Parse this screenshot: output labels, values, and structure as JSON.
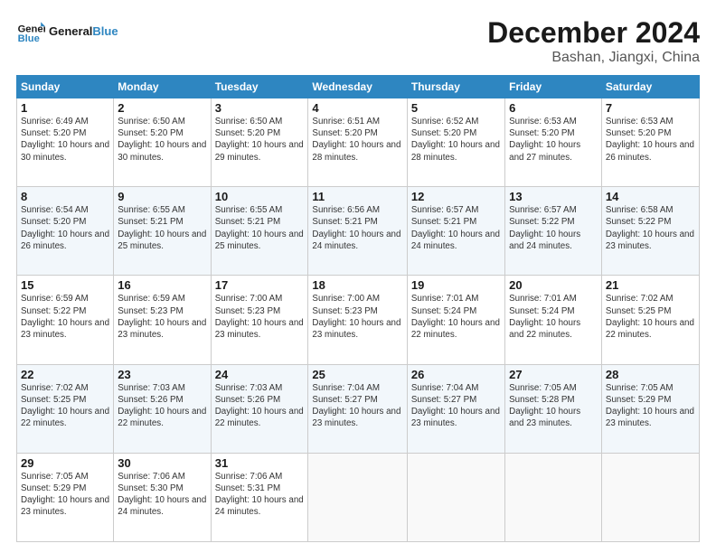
{
  "header": {
    "logo_line1": "General",
    "logo_line2": "Blue",
    "month": "December 2024",
    "location": "Bashan, Jiangxi, China"
  },
  "weekdays": [
    "Sunday",
    "Monday",
    "Tuesday",
    "Wednesday",
    "Thursday",
    "Friday",
    "Saturday"
  ],
  "weeks": [
    [
      {
        "day": "1",
        "sunrise": "Sunrise: 6:49 AM",
        "sunset": "Sunset: 5:20 PM",
        "daylight": "Daylight: 10 hours and 30 minutes."
      },
      {
        "day": "2",
        "sunrise": "Sunrise: 6:50 AM",
        "sunset": "Sunset: 5:20 PM",
        "daylight": "Daylight: 10 hours and 30 minutes."
      },
      {
        "day": "3",
        "sunrise": "Sunrise: 6:50 AM",
        "sunset": "Sunset: 5:20 PM",
        "daylight": "Daylight: 10 hours and 29 minutes."
      },
      {
        "day": "4",
        "sunrise": "Sunrise: 6:51 AM",
        "sunset": "Sunset: 5:20 PM",
        "daylight": "Daylight: 10 hours and 28 minutes."
      },
      {
        "day": "5",
        "sunrise": "Sunrise: 6:52 AM",
        "sunset": "Sunset: 5:20 PM",
        "daylight": "Daylight: 10 hours and 28 minutes."
      },
      {
        "day": "6",
        "sunrise": "Sunrise: 6:53 AM",
        "sunset": "Sunset: 5:20 PM",
        "daylight": "Daylight: 10 hours and 27 minutes."
      },
      {
        "day": "7",
        "sunrise": "Sunrise: 6:53 AM",
        "sunset": "Sunset: 5:20 PM",
        "daylight": "Daylight: 10 hours and 26 minutes."
      }
    ],
    [
      {
        "day": "8",
        "sunrise": "Sunrise: 6:54 AM",
        "sunset": "Sunset: 5:20 PM",
        "daylight": "Daylight: 10 hours and 26 minutes."
      },
      {
        "day": "9",
        "sunrise": "Sunrise: 6:55 AM",
        "sunset": "Sunset: 5:21 PM",
        "daylight": "Daylight: 10 hours and 25 minutes."
      },
      {
        "day": "10",
        "sunrise": "Sunrise: 6:55 AM",
        "sunset": "Sunset: 5:21 PM",
        "daylight": "Daylight: 10 hours and 25 minutes."
      },
      {
        "day": "11",
        "sunrise": "Sunrise: 6:56 AM",
        "sunset": "Sunset: 5:21 PM",
        "daylight": "Daylight: 10 hours and 24 minutes."
      },
      {
        "day": "12",
        "sunrise": "Sunrise: 6:57 AM",
        "sunset": "Sunset: 5:21 PM",
        "daylight": "Daylight: 10 hours and 24 minutes."
      },
      {
        "day": "13",
        "sunrise": "Sunrise: 6:57 AM",
        "sunset": "Sunset: 5:22 PM",
        "daylight": "Daylight: 10 hours and 24 minutes."
      },
      {
        "day": "14",
        "sunrise": "Sunrise: 6:58 AM",
        "sunset": "Sunset: 5:22 PM",
        "daylight": "Daylight: 10 hours and 23 minutes."
      }
    ],
    [
      {
        "day": "15",
        "sunrise": "Sunrise: 6:59 AM",
        "sunset": "Sunset: 5:22 PM",
        "daylight": "Daylight: 10 hours and 23 minutes."
      },
      {
        "day": "16",
        "sunrise": "Sunrise: 6:59 AM",
        "sunset": "Sunset: 5:23 PM",
        "daylight": "Daylight: 10 hours and 23 minutes."
      },
      {
        "day": "17",
        "sunrise": "Sunrise: 7:00 AM",
        "sunset": "Sunset: 5:23 PM",
        "daylight": "Daylight: 10 hours and 23 minutes."
      },
      {
        "day": "18",
        "sunrise": "Sunrise: 7:00 AM",
        "sunset": "Sunset: 5:23 PM",
        "daylight": "Daylight: 10 hours and 23 minutes."
      },
      {
        "day": "19",
        "sunrise": "Sunrise: 7:01 AM",
        "sunset": "Sunset: 5:24 PM",
        "daylight": "Daylight: 10 hours and 22 minutes."
      },
      {
        "day": "20",
        "sunrise": "Sunrise: 7:01 AM",
        "sunset": "Sunset: 5:24 PM",
        "daylight": "Daylight: 10 hours and 22 minutes."
      },
      {
        "day": "21",
        "sunrise": "Sunrise: 7:02 AM",
        "sunset": "Sunset: 5:25 PM",
        "daylight": "Daylight: 10 hours and 22 minutes."
      }
    ],
    [
      {
        "day": "22",
        "sunrise": "Sunrise: 7:02 AM",
        "sunset": "Sunset: 5:25 PM",
        "daylight": "Daylight: 10 hours and 22 minutes."
      },
      {
        "day": "23",
        "sunrise": "Sunrise: 7:03 AM",
        "sunset": "Sunset: 5:26 PM",
        "daylight": "Daylight: 10 hours and 22 minutes."
      },
      {
        "day": "24",
        "sunrise": "Sunrise: 7:03 AM",
        "sunset": "Sunset: 5:26 PM",
        "daylight": "Daylight: 10 hours and 22 minutes."
      },
      {
        "day": "25",
        "sunrise": "Sunrise: 7:04 AM",
        "sunset": "Sunset: 5:27 PM",
        "daylight": "Daylight: 10 hours and 23 minutes."
      },
      {
        "day": "26",
        "sunrise": "Sunrise: 7:04 AM",
        "sunset": "Sunset: 5:27 PM",
        "daylight": "Daylight: 10 hours and 23 minutes."
      },
      {
        "day": "27",
        "sunrise": "Sunrise: 7:05 AM",
        "sunset": "Sunset: 5:28 PM",
        "daylight": "Daylight: 10 hours and 23 minutes."
      },
      {
        "day": "28",
        "sunrise": "Sunrise: 7:05 AM",
        "sunset": "Sunset: 5:29 PM",
        "daylight": "Daylight: 10 hours and 23 minutes."
      }
    ],
    [
      {
        "day": "29",
        "sunrise": "Sunrise: 7:05 AM",
        "sunset": "Sunset: 5:29 PM",
        "daylight": "Daylight: 10 hours and 23 minutes."
      },
      {
        "day": "30",
        "sunrise": "Sunrise: 7:06 AM",
        "sunset": "Sunset: 5:30 PM",
        "daylight": "Daylight: 10 hours and 24 minutes."
      },
      {
        "day": "31",
        "sunrise": "Sunrise: 7:06 AM",
        "sunset": "Sunset: 5:31 PM",
        "daylight": "Daylight: 10 hours and 24 minutes."
      },
      null,
      null,
      null,
      null
    ]
  ]
}
